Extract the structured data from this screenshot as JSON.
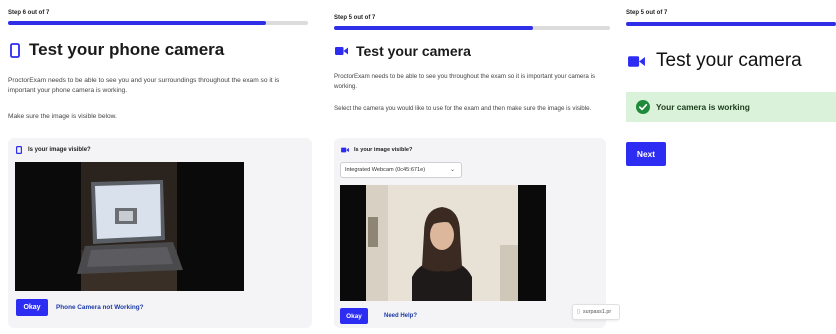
{
  "phone_panel": {
    "step": "Step 6 out of 7",
    "progress": 0.86,
    "title": "Test your phone camera",
    "para1": "ProctorExam needs to be able to see you and your surroundings throughout the exam so it is important your phone camera is working.",
    "para2": "Make sure the image is visible below.",
    "card_title": "Is your image visible?",
    "okay_label": "Okay",
    "link_label": "Phone Camera not Working?"
  },
  "webcam_panel": {
    "step": "Step 5 out of 7",
    "progress": 0.72,
    "title": "Test your camera",
    "para1": "ProctorExam needs to be able to see you throughout the exam so it is important your camera is working.",
    "para2": "Select the camera you would like to use for the exam and then make sure the image is visible.",
    "card_title": "Is your image visible?",
    "select_value": "Integrated Webcam (0c45:671e)",
    "okay_label": "Okay",
    "link_label": "Need Help?",
    "download_chip": "surpass1.pr"
  },
  "result_panel": {
    "step": "Step 5 out of 7",
    "progress": 1.0,
    "title": "Test your camera",
    "status": "Your camera is working",
    "next_label": "Next"
  },
  "colors": {
    "accent": "#2c2cf2",
    "success_bg": "#d9f2d9",
    "success_icon": "#1f8b3a",
    "link": "#1c3aa8"
  },
  "icons": [
    "phone-icon",
    "video-camera-icon",
    "check-circle-icon",
    "chevron-down-icon",
    "laptop-preview-image",
    "person-preview-image"
  ]
}
